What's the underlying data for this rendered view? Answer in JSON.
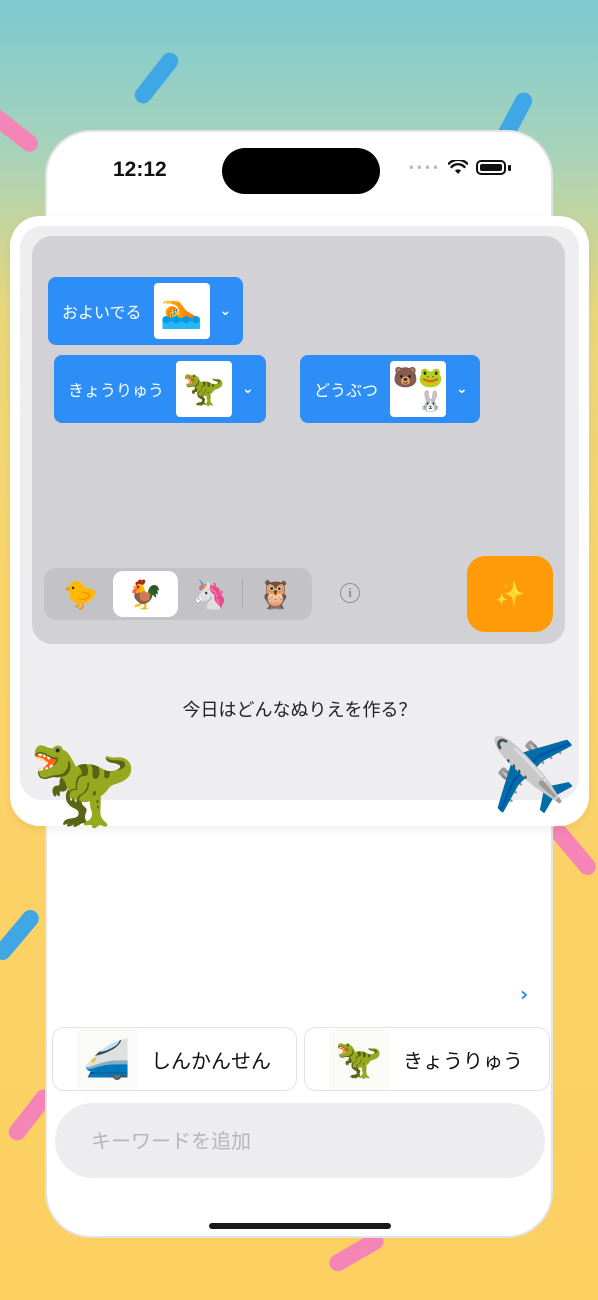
{
  "status_bar": {
    "time": "12:12",
    "signal_icon": "cellular-dots-icon",
    "wifi_icon": "wifi-icon",
    "battery_icon": "battery-icon"
  },
  "canvas": {
    "chips": [
      {
        "label": "およいでる",
        "image": "🏊",
        "image_icon": "swimmer-icon"
      },
      {
        "label": "きょうりゅう",
        "image": "🦖",
        "image_icon": "dinosaur-icon"
      },
      {
        "label": "どうぶつ",
        "image": [
          "🐻",
          "🐸",
          "🐱",
          "🐰"
        ],
        "image_icon": "animals-icon"
      }
    ],
    "chip_dropdown_glyph": "⌄",
    "animal_options": [
      {
        "glyph": "🐤",
        "name": "chick",
        "selected": false
      },
      {
        "glyph": "🐓",
        "name": "rooster",
        "selected": true
      },
      {
        "glyph": "🦄",
        "name": "unicorn",
        "selected": false
      },
      {
        "glyph": "🦉",
        "name": "owl",
        "selected": false
      }
    ],
    "info_glyph": "i",
    "magic_glyph": "✨",
    "accent_color": "#2e8ef7",
    "magic_color": "#ff9a08"
  },
  "prompt": "今日はどんなぬりえを作る？",
  "decorations": {
    "left": "🦖",
    "right": "✈️"
  },
  "more_chevron": "›",
  "suggestions": [
    {
      "label": "しんかんせん",
      "image": "🚄",
      "image_icon": "bullet-train-icon"
    },
    {
      "label": "きょうりゅう",
      "image": "🦖",
      "image_icon": "dinosaur-icon"
    }
  ],
  "keyword_input": {
    "placeholder": "キーワードを追加",
    "value": ""
  }
}
